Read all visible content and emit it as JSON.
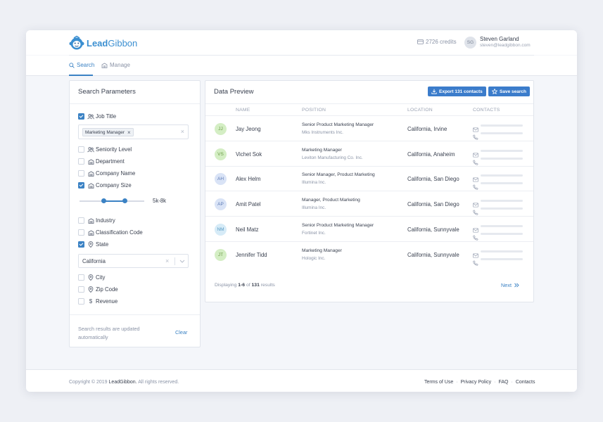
{
  "brand": {
    "name_part1": "Lead",
    "name_part2": "Gibbon"
  },
  "header": {
    "credits": "2726 credits",
    "user_initials": "SG",
    "user_name": "Steven Garland",
    "user_email": "steven@leadgibbon.com"
  },
  "tabs": [
    {
      "label": "Search",
      "icon": "search-icon",
      "active": true
    },
    {
      "label": "Manage",
      "icon": "building-icon",
      "active": false
    }
  ],
  "search_params": {
    "title": "Search Parameters",
    "filters": [
      {
        "label": "Job Title",
        "icon": "users-icon",
        "checked": true
      },
      {
        "label": "Seniority Level",
        "icon": "users-icon",
        "checked": false
      },
      {
        "label": "Department",
        "icon": "building-icon",
        "checked": false
      },
      {
        "label": "Company Name",
        "icon": "building-icon",
        "checked": false
      },
      {
        "label": "Company Size",
        "icon": "building-icon",
        "checked": true
      },
      {
        "label": "Industry",
        "icon": "building-icon",
        "checked": false
      },
      {
        "label": "Classification Code",
        "icon": "building-icon",
        "checked": false
      },
      {
        "label": "State",
        "icon": "pin-icon",
        "checked": true
      },
      {
        "label": "City",
        "icon": "pin-icon",
        "checked": false
      },
      {
        "label": "Zip Code",
        "icon": "pin-icon",
        "checked": false
      },
      {
        "label": "Revenue",
        "icon": "dollar-icon",
        "checked": false
      }
    ],
    "job_title_tag": "Marketing Manager",
    "company_size_value": "5k-8k",
    "state_value": "California",
    "note": "Search results are updated automatically",
    "clear_label": "Clear"
  },
  "preview": {
    "title": "Data Preview",
    "export_label": "Export 131 contacts",
    "save_label": "Save search",
    "columns": [
      "NAME",
      "POSITION",
      "LOCATION",
      "CONTACTS"
    ],
    "rows": [
      {
        "initials": "JJ",
        "color": "#d4eec4",
        "text_color": "#6a9a45",
        "name": "Jay Jeong",
        "position": "Senior Product Marketing Manager",
        "company": "Mks Instruments Inc.",
        "location": "California, Irvine"
      },
      {
        "initials": "VS",
        "color": "#d4eec4",
        "text_color": "#6a9a45",
        "name": "Vichet Sok",
        "position": "Marketing Manager",
        "company": "Leviton Manufacturing Co. Inc.",
        "location": "California, Anaheim"
      },
      {
        "initials": "AH",
        "color": "#d9e3f6",
        "text_color": "#5d7bb5",
        "name": "Alex Helm",
        "position": "Senior Manager, Product Marketing",
        "company": "Illumina Inc.",
        "location": "California, San Diego"
      },
      {
        "initials": "AP",
        "color": "#d9e3f6",
        "text_color": "#5d7bb5",
        "name": "Amit Patel",
        "position": "Manager, Product Marketing",
        "company": "Illumina Inc.",
        "location": "California, San Diego"
      },
      {
        "initials": "NM",
        "color": "#d6ebf7",
        "text_color": "#5a9bc4",
        "name": "Neil Matz",
        "position": "Senior Product Marketing Manager",
        "company": "Fortinet Inc.",
        "location": "California, Sunnyvale"
      },
      {
        "initials": "JT",
        "color": "#d4eec4",
        "text_color": "#6a9a45",
        "name": "Jennifer Tidd",
        "position": "Marketing Manager",
        "company": "Hologic Inc.",
        "location": "California, Sunnyvale"
      }
    ],
    "pager_prefix": "Displaying",
    "pager_range": "1-6",
    "pager_of": "of",
    "pager_total": "131",
    "pager_suffix": "results",
    "next_label": "Next"
  },
  "footer": {
    "copyright_prefix": "Copyright © 2019",
    "copyright_brand": "LeadGibbon.",
    "copyright_suffix": "All rights reserved.",
    "links": [
      "Terms of Use",
      "Privacy Policy",
      "FAQ",
      "Contacts"
    ]
  },
  "colors": {
    "accent": "#3b82c4",
    "brand": "#3b8fd1",
    "button": "#3b7ccb"
  }
}
